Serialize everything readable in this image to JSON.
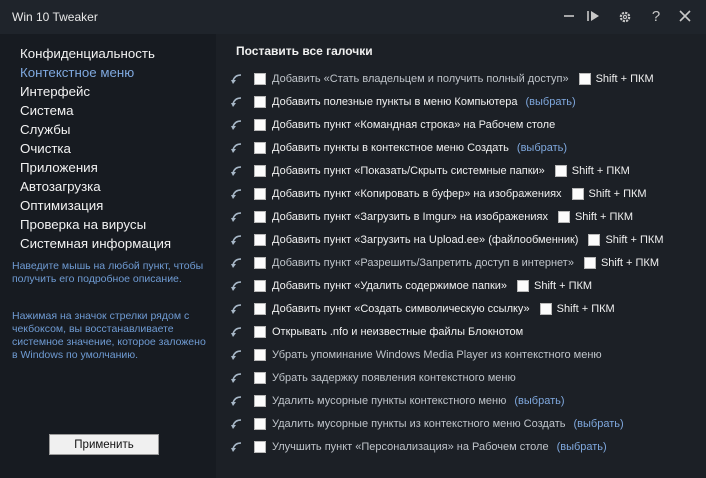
{
  "window": {
    "title": "Win 10 Tweaker"
  },
  "titlebar": {
    "buttons": [
      "minimize-icon",
      "play-icon",
      "gear-icon",
      "help-icon",
      "close-icon"
    ],
    "help_glyph": "?"
  },
  "sidebar": {
    "items": [
      {
        "label": "Конфиденциальность"
      },
      {
        "label": "Контекстное меню",
        "active": true
      },
      {
        "label": "Интерфейс"
      },
      {
        "label": "Система"
      },
      {
        "label": "Службы"
      },
      {
        "label": "Очистка"
      },
      {
        "label": "Приложения"
      },
      {
        "label": "Автозагрузка"
      },
      {
        "label": "Оптимизация"
      },
      {
        "label": "Проверка на вирусы"
      },
      {
        "label": "Системная информация"
      }
    ],
    "hint1": "Наведите мышь на любой пункт, чтобы получить его подробное описание.",
    "hint2": "Нажимая на значок стрелки рядом с чекбоксом, вы восстанавливаете системное значение, которое заложено в Windows по умолчанию.",
    "apply_label": "Применить"
  },
  "main": {
    "title": "Поставить все галочки",
    "select_link": "(выбрать)",
    "hotkey_label": "Shift + ПКМ",
    "rows": [
      {
        "label": "Добавить «Стать владельцем и получить полный доступ»",
        "dim": true,
        "hotkey": true
      },
      {
        "label": "Добавить полезные пункты в меню Компьютера",
        "link": true
      },
      {
        "label": "Добавить пункт «Командная строка» на Рабочем столе"
      },
      {
        "label": "Добавить пункты в контекстное меню Создать",
        "link": true
      },
      {
        "label": "Добавить пункт «Показать/Скрыть системные папки»",
        "hotkey": true
      },
      {
        "label": "Добавить пункт «Копировать в буфер» на изображениях",
        "hotkey": true
      },
      {
        "label": "Добавить пункт «Загрузить в Imgur» на изображениях",
        "hotkey": true
      },
      {
        "label": "Добавить пункт «Загрузить на Upload.ee» (файлообменник)",
        "hotkey": true
      },
      {
        "label": "Добавить пункт «Разрешить/Запретить доступ в интернет»",
        "dim": true,
        "hotkey": true
      },
      {
        "label": "Добавить пункт «Удалить содержимое папки»",
        "hotkey": true
      },
      {
        "label": "Добавить пункт «Создать символическую ссылку»",
        "hotkey": true
      },
      {
        "label": "Открывать .nfo и неизвестные файлы Блокнотом"
      },
      {
        "label": "Убрать упоминание Windows Media Player из контекстного меню",
        "dim": true
      },
      {
        "label": "Убрать задержку появления контекстного меню",
        "dim": true
      },
      {
        "label": "Удалить мусорные пункты контекстного меню",
        "dim": true,
        "link": true
      },
      {
        "label": "Удалить мусорные пункты из контекстного меню Создать",
        "dim": true,
        "link": true
      },
      {
        "label": "Улучшить пункт «Персонализация» на Рабочем столе",
        "dim": true,
        "link": true
      }
    ]
  },
  "colors": {
    "accent": "#7fa8de",
    "background": "#1c2026",
    "sidebar": "#171b21"
  }
}
